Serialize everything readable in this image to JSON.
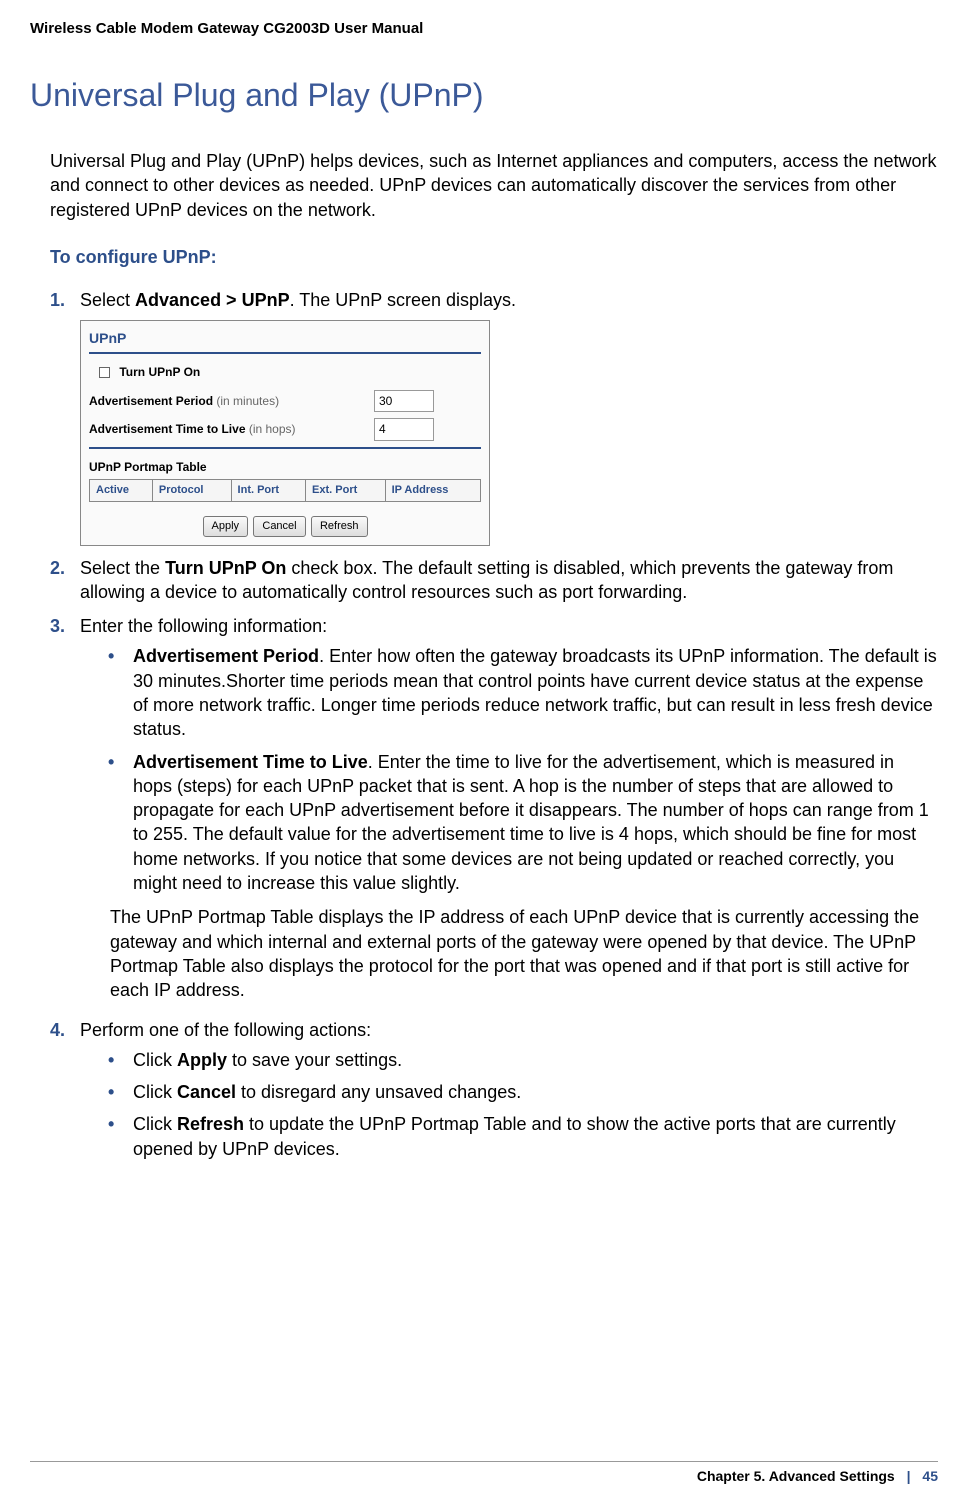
{
  "header": {
    "doc_title": "Wireless Cable Modem Gateway CG2003D User Manual"
  },
  "title": "Universal Plug and Play (UPnP)",
  "intro": "Universal Plug and Play (UPnP) helps devices, such as Internet appliances and computers, access the network and connect to other devices as needed. UPnP devices can automatically discover the services from other registered UPnP devices on the network.",
  "subhead": "To configure UPnP:",
  "step1": {
    "number": "1",
    "text_a": "Select ",
    "bold": "Advanced > UPnP",
    "text_b": ". The UPnP screen displays."
  },
  "screenshot": {
    "panel_title": "UPnP",
    "checkbox_label": "Turn UPnP On",
    "field1_label": "Advertisement Period",
    "field1_hint": " (in minutes)",
    "field1_value": "30",
    "field2_label": "Advertisement Time to Live",
    "field2_hint": " (in hops)",
    "field2_value": "4",
    "table_title": "UPnP Portmap Table",
    "columns": {
      "c0": "Active",
      "c1": "Protocol",
      "c2": "Int. Port",
      "c3": "Ext. Port",
      "c4": "IP Address"
    },
    "buttons": {
      "apply": "Apply",
      "cancel": "Cancel",
      "refresh": "Refresh"
    }
  },
  "step2": {
    "number": "2",
    "text_a": "Select the ",
    "bold": "Turn UPnP On",
    "text_b": " check box. The default setting is disabled, which prevents the gateway from allowing a device to automatically control resources such as port forwarding."
  },
  "step3": {
    "number": "3",
    "lead": "Enter the following information:",
    "bullet1_bold": "Advertisement Period",
    "bullet1_text": ". Enter how often the gateway broadcasts its UPnP information. The default is 30 minutes.Shorter time periods mean that control points have current device status at the expense of more network traffic. Longer time periods reduce network traffic, but can result in less fresh device status.",
    "bullet2_bold": "Advertisement Time to Live",
    "bullet2_text": ". Enter the time to live for the advertisement, which is measured in hops (steps) for each UPnP packet that is sent. A hop is the number of steps that are allowed to propagate for each UPnP advertisement before it disappears. The number of hops can range from 1 to 255. The default value for the advertisement time to live is 4 hops, which should be fine for most home networks. If you notice that some devices are not being updated or reached correctly, you might need to increase this value slightly.",
    "tail_para": "The UPnP Portmap Table displays the IP address of each UPnP device that is currently accessing the gateway and which internal and external ports of the gateway were opened by that device. The UPnP Portmap Table also displays the protocol for the port that was opened and if that port is still active for each IP address."
  },
  "step4": {
    "number": "4",
    "lead": "Perform one of the following actions:",
    "b1_a": "Click ",
    "b1_bold": "Apply",
    "b1_b": " to save your settings.",
    "b2_a": "Click ",
    "b2_bold": "Cancel",
    "b2_b": " to disregard any unsaved changes.",
    "b3_a": "Click ",
    "b3_bold": "Refresh",
    "b3_b": " to update the UPnP Portmap Table and to show the active ports that are currently opened by UPnP devices."
  },
  "footer": {
    "chapter": "Chapter 5.  Advanced Settings",
    "sep": "|",
    "page": "45"
  }
}
